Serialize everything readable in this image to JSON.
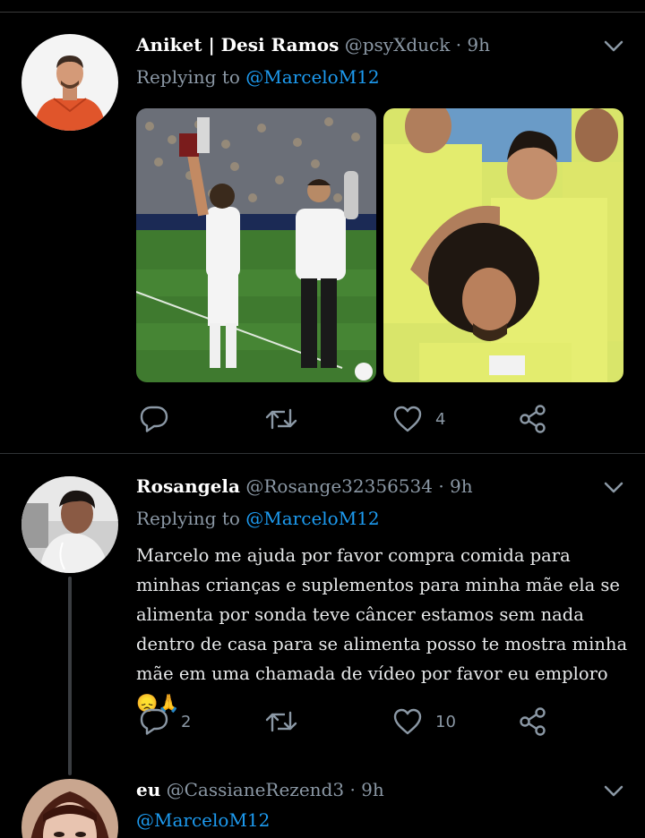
{
  "tweets": [
    {
      "author_name": "Aniket | Desi Ramos",
      "handle": "@psyXduck",
      "separator": "·",
      "time": "9h",
      "replying_prefix": "Replying to",
      "replying_to": "@MarceloM12",
      "media_count": 2,
      "reply_count": "",
      "retweet_count": "",
      "like_count": "4"
    },
    {
      "author_name": "Rosangela",
      "handle": "@Rosange32356534",
      "separator": "·",
      "time": "9h",
      "replying_prefix": "Replying to",
      "replying_to": "@MarceloM12",
      "text": "Marcelo me ajuda por favor compra comida para minhas crianças e suplementos para minha mãe ela se alimenta por sonda teve câncer estamos sem nada dentro de casa para se alimenta posso te mostra minha mãe em uma chamada de vídeo por favor eu emploro 😞🙏",
      "reply_count": "2",
      "retweet_count": "",
      "like_count": "10"
    },
    {
      "author_name": "eu",
      "handle": "@CassianeRezend3",
      "separator": "·",
      "time": "9h",
      "text": "@MarceloM12"
    }
  ],
  "icons": {
    "reply": "reply-bubble-icon",
    "retweet": "retweet-icon",
    "like": "heart-icon",
    "share": "share-icon",
    "menu": "chevron-down-icon"
  },
  "colors": {
    "background": "#000000",
    "text": "#e7e9ea",
    "secondary": "#8b98a5",
    "link": "#1d9bf0",
    "divider": "#2f3336"
  }
}
